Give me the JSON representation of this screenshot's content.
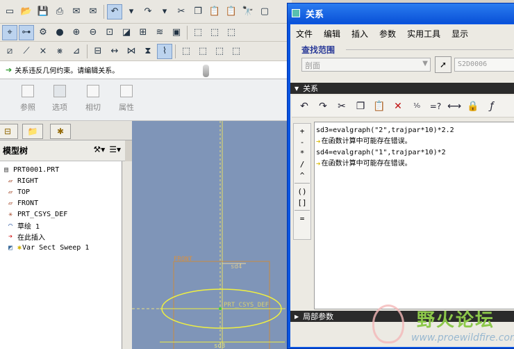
{
  "main": {
    "message": "关系违反几何约束。请编辑关系。",
    "dashboard": {
      "items": [
        {
          "label": "参照"
        },
        {
          "label": "选项"
        },
        {
          "label": "相切"
        },
        {
          "label": "属性"
        }
      ]
    }
  },
  "model_tree": {
    "title": "模型树",
    "items": [
      {
        "label": "PRT0001.PRT",
        "icon": "part-icon"
      },
      {
        "label": "RIGHT",
        "icon": "datum-plane-icon"
      },
      {
        "label": "TOP",
        "icon": "datum-plane-icon"
      },
      {
        "label": "FRONT",
        "icon": "datum-plane-icon"
      },
      {
        "label": "PRT_CSYS_DEF",
        "icon": "csys-icon"
      },
      {
        "label": "草绘 1",
        "icon": "sketch-icon"
      },
      {
        "label": "在此插入",
        "icon": "insert-here-icon"
      },
      {
        "label": "Var Sect Sweep 1",
        "icon": "sweep-feature-icon"
      }
    ]
  },
  "graphics": {
    "labels": {
      "front": "FRONT",
      "sd4": "sd4",
      "csys": "PRT_CSYS_DEF",
      "sd3": "sd3"
    }
  },
  "dialog": {
    "title": "关系",
    "menu": [
      "文件",
      "编辑",
      "插入",
      "参数",
      "实用工具",
      "显示"
    ],
    "scope": {
      "label": "查找范围",
      "combo_value": "剖面",
      "selected": "S2D0006"
    },
    "relations_section": "关系",
    "local_params_section": "局部参数",
    "operators": [
      "+",
      "-",
      "*",
      "/",
      "^",
      "()",
      "[]",
      "="
    ],
    "lines": [
      {
        "type": "code",
        "text": "sd3=evalgraph(\"2\",trajpar*10)*2.2"
      },
      {
        "type": "error",
        "text": "在函数计算中可能存在错误。"
      },
      {
        "type": "code",
        "text": "sd4=evalgraph(\"1\",trajpar*10)*2"
      },
      {
        "type": "error",
        "text": "在函数计算中可能存在错误。"
      }
    ]
  },
  "watermark": {
    "title": "野火论坛",
    "url": "www.proewildfire.com"
  },
  "colors": {
    "dialog_title": "#0a52d8",
    "graphics_bg": "#7f95b8",
    "sketch_yellow": "#f0f040",
    "error_arrow": "#d8b800"
  }
}
